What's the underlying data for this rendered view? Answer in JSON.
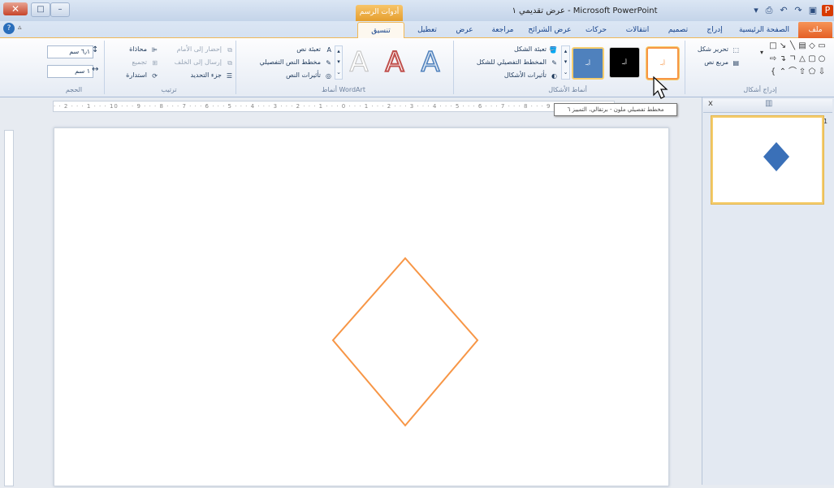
{
  "titlebar": {
    "app_title": "عرض تقديمي ١ - Microsoft PowerPoint",
    "contextual_tab_group": "أدوات الرسم",
    "close_symbol": "✕",
    "restore_symbol": "□",
    "minimize_symbol": "–",
    "help_symbol": "?",
    "collapse_symbol": "▵"
  },
  "tabs": {
    "file": "ملف",
    "home": "الصفحة الرئيسية",
    "insert": "إدراج",
    "design": "تصميم",
    "transitions": "انتقالات",
    "animations": "حركات",
    "slideshow": "عرض الشرائح",
    "review": "مراجعة",
    "view": "عرض",
    "addins": "تعطيل",
    "format": "تنسيق"
  },
  "ribbon": {
    "insert_shapes": {
      "label": "إدراج أشكال",
      "edit_shape": "تحرير شكل",
      "text_box": "مربع نص"
    },
    "shape_styles": {
      "label": "أنماط الأشكال",
      "swatch_text": "أبـ",
      "shape_fill": "تعبئة الشكل",
      "shape_outline": "المخطط التفصيلي للشكل",
      "shape_effects": "تأثيرات الأشكال"
    },
    "wordart": {
      "label": "أنماط WordArt",
      "letter": "A",
      "text_fill": "تعبئة نص",
      "text_outline": "مخطط النص التفصيلي",
      "text_effects": "تأثيرات النص"
    },
    "arrange": {
      "label": "ترتيب",
      "bring_forward": "إحضار إلى الأمام",
      "send_backward": "إرسال إلى الخلف",
      "selection_pane": "جزء التحديد",
      "align": "محاذاة",
      "group": "تجميع",
      "rotate": "استدارة"
    },
    "size": {
      "label": "الحجم",
      "height": "٦٫١ سم",
      "width": "١ سم"
    }
  },
  "tooltip": "مخطط تفصيلي ملون - برتقالي، التمييز ٦",
  "ruler_text": "· · 2 · · · 1 · · · 10 · · · 9 · · · 8 · · · 7 · · · 6 · · · 5 · · · 4 · · · 3 · · · 2 · · · 1 · · · 0 · · · 1 · · · 2 · · · 3 · · · 4 · · · 5 · · · 6 · · · 7 · · · 8 · · · 9 · · ·",
  "pane": {
    "close_symbol": "x",
    "slide_number": "1"
  },
  "colors": {
    "accent_orange": "#f79646",
    "thumb_shape_blue": "#3a70b8",
    "style_blue": "#4f81bd",
    "file_tab": "#e45f25"
  }
}
